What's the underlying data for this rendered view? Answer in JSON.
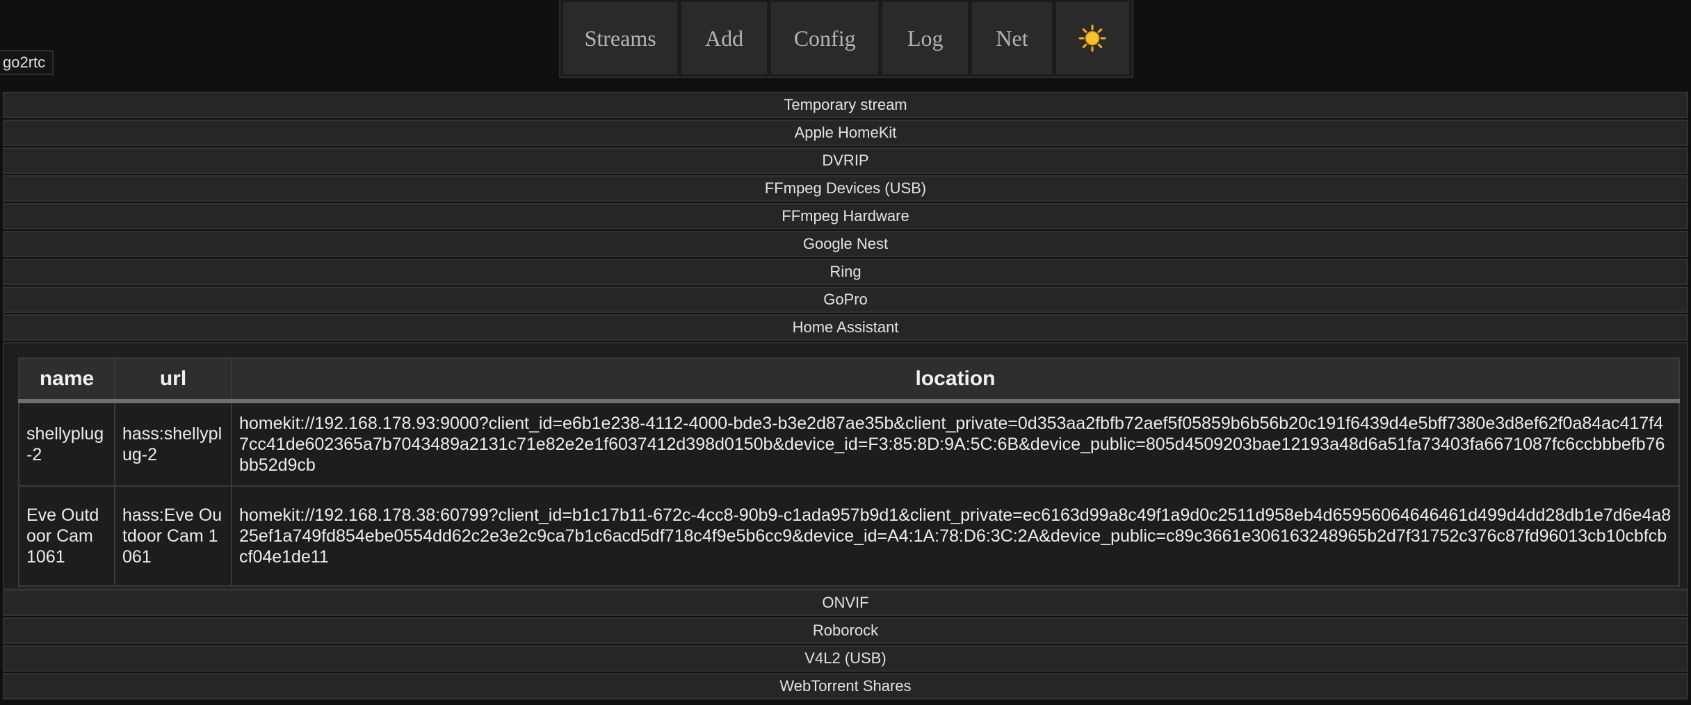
{
  "nav": {
    "items": [
      "Streams",
      "Add",
      "Config",
      "Log",
      "Net"
    ],
    "theme_icon": "sun-icon"
  },
  "app_tag": "go2rtc",
  "sections_top": [
    "Temporary stream",
    "Apple HomeKit",
    "DVRIP",
    "FFmpeg Devices (USB)",
    "FFmpeg Hardware",
    "Google Nest",
    "Ring",
    "GoPro",
    "Home Assistant"
  ],
  "home_assistant": {
    "columns": [
      "name",
      "url",
      "location"
    ],
    "rows": [
      {
        "name": "shellyplug-2",
        "url": "hass:shellyplug-2",
        "location": "homekit://192.168.178.93:9000?client_id=e6b1e238-4112-4000-bde3-b3e2d87ae35b&client_private=0d353aa2fbfb72aef5f05859b6b56b20c191f6439d4e5bff7380e3d8ef62f0a84ac417f47cc41de602365a7b7043489a2131c71e82e2e1f6037412d398d0150b&device_id=F3:85:8D:9A:5C:6B&device_public=805d4509203bae12193a48d6a51fa73403fa6671087fc6ccbbbefb76bb52d9cb"
      },
      {
        "name": "Eve Outdoor Cam 1061",
        "url": "hass:Eve Outdoor Cam 1061",
        "location": "homekit://192.168.178.38:60799?client_id=b1c17b11-672c-4cc8-90b9-c1ada957b9d1&client_private=ec6163d99a8c49f1a9d0c2511d958eb4d65956064646461d499d4dd28db1e7d6e4a825ef1a749fd854ebe0554dd62c2e3e2c9ca7b1c6acd5df718c4f9e5b6cc9&device_id=A4:1A:78:D6:3C:2A&device_public=c89c3661e306163248965b2d7f31752c376c87fd96013cb10cbfcbcf04e1de11"
      }
    ]
  },
  "sections_bottom": [
    "ONVIF",
    "Roborock",
    "V4L2 (USB)",
    "WebTorrent Shares"
  ]
}
